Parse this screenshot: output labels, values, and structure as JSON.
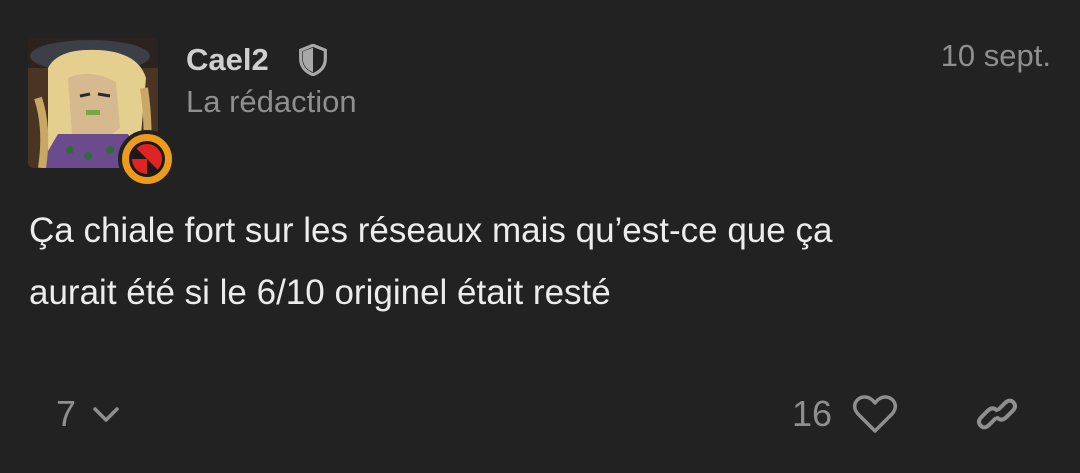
{
  "post": {
    "author": {
      "username": "Cael2",
      "group": "La rédaction",
      "badge_icon": "shield-icon",
      "avatar_icon": "anime-character-avatar",
      "flair_icon": "red-circle-flair-icon"
    },
    "date": "10 sept.",
    "content": {
      "line1": "Ça chiale fort sur les réseaux mais qu’est-ce que ça",
      "line2": "aurait été si le 6/10 originel était resté"
    },
    "actions": {
      "replies_count": "7",
      "replies_icon": "chevron-down-icon",
      "likes_count": "16",
      "like_icon": "heart-icon",
      "link_icon": "link-icon"
    }
  },
  "colors": {
    "background": "#222222",
    "text_primary": "#ececec",
    "text_secondary": "#8f8f8f",
    "flair_ring": "#ee9a1a",
    "flair_fill": "#e02424"
  }
}
